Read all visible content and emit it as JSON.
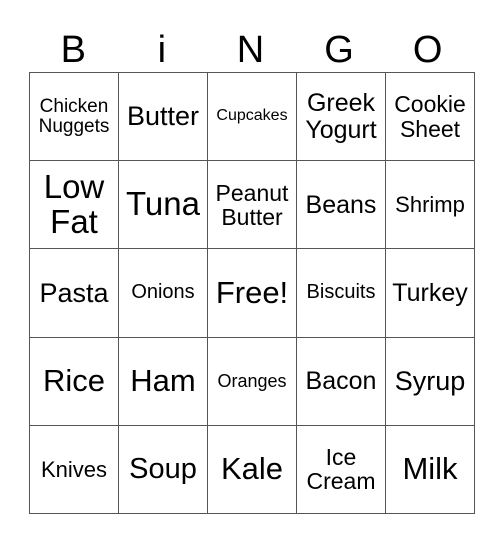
{
  "header": {
    "letters": [
      "B",
      "i",
      "N",
      "G",
      "O"
    ]
  },
  "grid": {
    "rows": [
      [
        "Chicken Nuggets",
        "Butter",
        "Cupcakes",
        "Greek Yogurt",
        "Cookie Sheet"
      ],
      [
        "Low Fat",
        "Tuna",
        "Peanut Butter",
        "Beans",
        "Shrimp"
      ],
      [
        "Pasta",
        "Onions",
        "Free!",
        "Biscuits",
        "Turkey"
      ],
      [
        "Rice",
        "Ham",
        "Oranges",
        "Bacon",
        "Syrup"
      ],
      [
        "Knives",
        "Soup",
        "Kale",
        "Ice Cream",
        "Milk"
      ]
    ],
    "display": [
      [
        "Chicken\nNuggets",
        "Butter",
        "Cupcakes",
        "Greek\nYogurt",
        "Cookie\nSheet"
      ],
      [
        "Low\nFat",
        "Tuna",
        "Peanut\nButter",
        "Beans",
        "Shrimp"
      ],
      [
        "Pasta",
        "Onions",
        "Free!",
        "Biscuits",
        "Turkey"
      ],
      [
        "Rice",
        "Ham",
        "Oranges",
        "Bacon",
        "Syrup"
      ],
      [
        "Knives",
        "Soup",
        "Kale",
        "Ice\nCream",
        "Milk"
      ]
    ]
  }
}
